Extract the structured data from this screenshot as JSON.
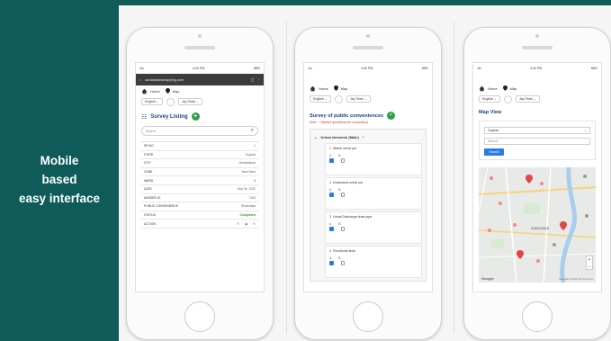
{
  "left": {
    "lines": [
      "Mobile",
      "based",
      "easy interface"
    ]
  },
  "statusbar": {
    "carrier": "Jio",
    "time": "4:42 PM",
    "battery": "88%"
  },
  "browser": {
    "url": "sardarplansmapping.com"
  },
  "nav": {
    "home": "Home",
    "map": "Map"
  },
  "selects": {
    "language": "English",
    "user": "Jay Shah"
  },
  "screen1": {
    "title": "Survey Listing",
    "search_placeholder": "Search",
    "rows": [
      {
        "key": "SR.NO",
        "value": "1"
      },
      {
        "key": "STATE",
        "value": "Gujarat"
      },
      {
        "key": "CITY",
        "value": "Ahmedabad"
      },
      {
        "key": "ZONE",
        "value": "New West"
      },
      {
        "key": "WARD",
        "value": "8"
      },
      {
        "key": "DATE",
        "value": "Sep 06, 2020"
      },
      {
        "key": "ANSSER ID",
        "value": "7164"
      },
      {
        "key": "PUBLIC CONVENIENCE",
        "value": "Ghatlodiya"
      },
      {
        "key": "STATUS",
        "value": "Completed"
      },
      {
        "key": "ACTION",
        "value": ""
      }
    ]
  },
  "screen2": {
    "title": "Survey of public conveniences",
    "note": "Note : * Marked questions are compulsory",
    "section": "Urinal elements (Male)",
    "questions": [
      {
        "no": "1",
        "text": "Attach urinal pot"
      },
      {
        "no": "2",
        "text": "Uncleaned urinal pot"
      },
      {
        "no": "3",
        "text": "Urinal Discharge drain pipe"
      },
      {
        "no": "4",
        "text": "Functional flush"
      }
    ],
    "options": [
      "A",
      "B"
    ]
  },
  "screen3": {
    "title": "Map View",
    "state_select": "Gujarat",
    "search_placeholder": "Search",
    "search_button": "Search",
    "map_labels": [
      "AHMEDABAD",
      "Google",
      "Map data ©2020  Terms of Use"
    ],
    "zoom_in": "+",
    "zoom_out": "−"
  }
}
